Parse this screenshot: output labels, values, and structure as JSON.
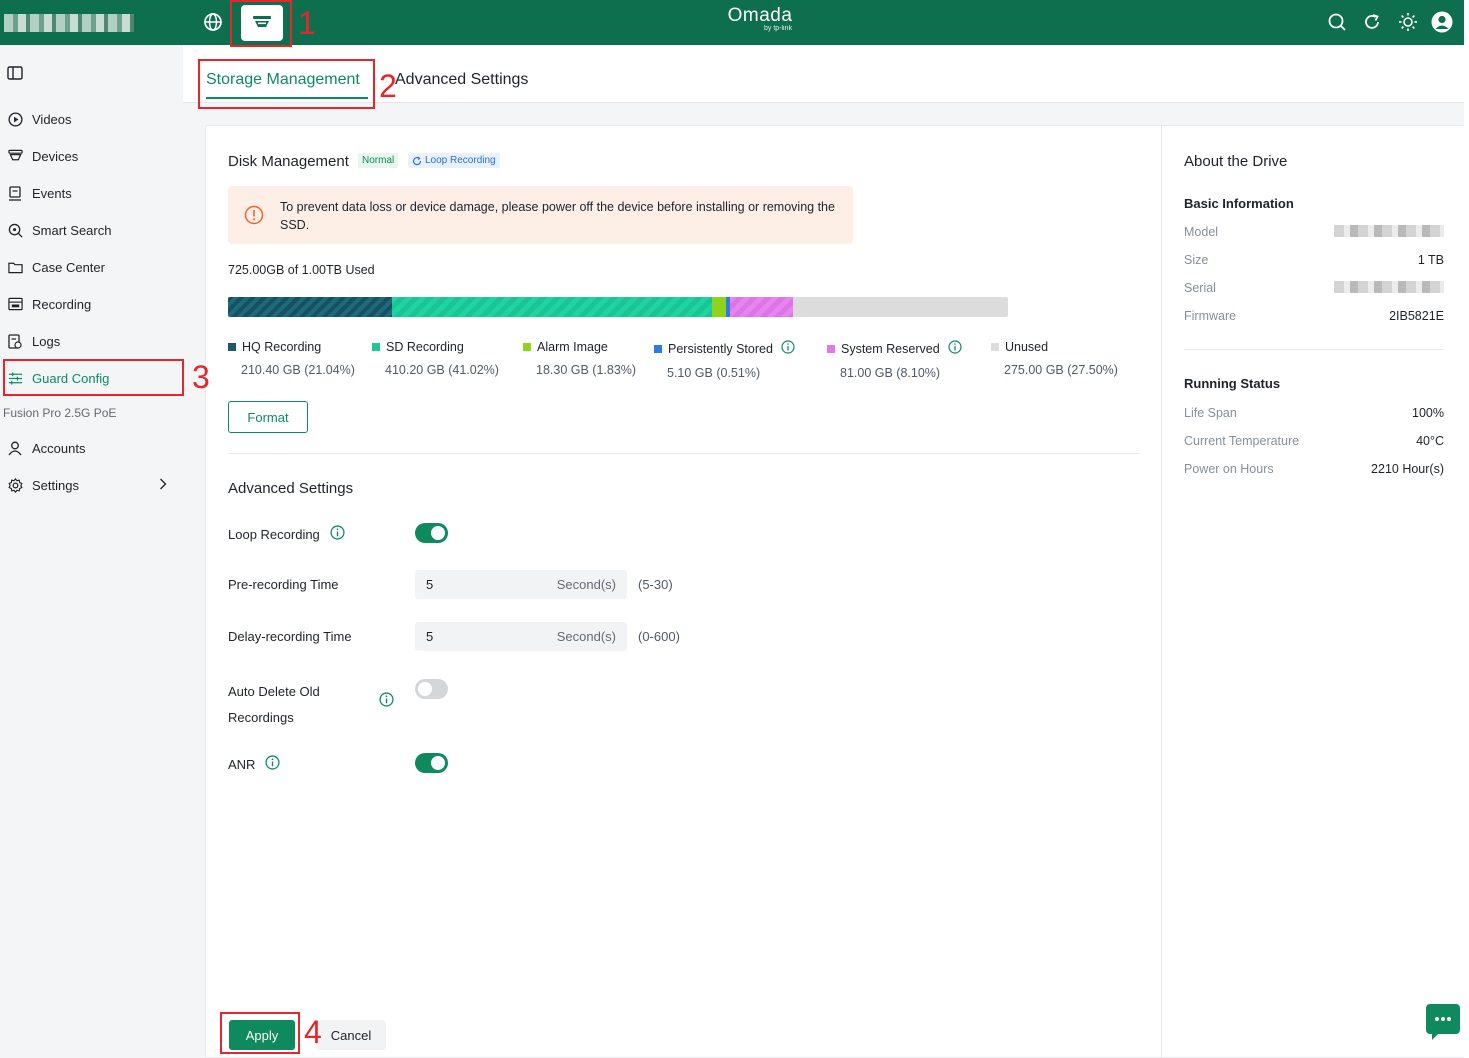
{
  "header": {
    "brand_name": "Omada",
    "brand_sub": "by tp-link"
  },
  "annotations": [
    "1",
    "2",
    "3",
    "4"
  ],
  "sidebar": {
    "items": [
      {
        "label": "Videos",
        "icon": "play-circle-icon"
      },
      {
        "label": "Devices",
        "icon": "camera-icon"
      },
      {
        "label": "Events",
        "icon": "events-icon"
      },
      {
        "label": "Smart Search",
        "icon": "smart-search-icon"
      },
      {
        "label": "Case Center",
        "icon": "folder-icon"
      },
      {
        "label": "Recording",
        "icon": "recording-icon"
      },
      {
        "label": "Logs",
        "icon": "logs-icon"
      },
      {
        "label": "Guard Config",
        "icon": "config-sliders-icon",
        "active": true
      }
    ],
    "section_label": "Fusion Pro 2.5G PoE",
    "bottom_items": [
      {
        "label": "Accounts",
        "icon": "user-icon"
      },
      {
        "label": "Settings",
        "icon": "gear-icon"
      }
    ]
  },
  "tabs": {
    "storage": "Storage Management",
    "advanced": "Advanced Settings"
  },
  "disk": {
    "title": "Disk Management",
    "badge_status": "Normal",
    "badge_loop": "Loop Recording",
    "warning": "To prevent data loss or device damage, please power off the device before installing or removing the SSD.",
    "usage": "725.00GB of 1.00TB Used",
    "segments_percent": {
      "hq": 21.04,
      "sd": 41.02,
      "alarm": 1.83,
      "persistent": 0.51,
      "system": 8.1,
      "unused": 27.5
    },
    "legend": [
      {
        "label": "HQ Recording",
        "value": "210.40 GB (21.04%)",
        "color": "#1c5a6b",
        "info": false
      },
      {
        "label": "SD Recording",
        "value": "410.20 GB (41.02%)",
        "color": "#1fc795",
        "info": false
      },
      {
        "label": "Alarm Image",
        "value": "18.30 GB (1.83%)",
        "color": "#8fd31d",
        "info": false
      },
      {
        "label": "Persistently Stored",
        "value": "5.10 GB (0.51%)",
        "color": "#2e7ae6",
        "info": true
      },
      {
        "label": "System Reserved",
        "value": "81.00 GB (8.10%)",
        "color": "#e07ae9",
        "info": true
      },
      {
        "label": "Unused",
        "value": "275.00 GB (27.50%)",
        "color": "#dcdcdc",
        "info": false
      }
    ],
    "format_label": "Format"
  },
  "advanced": {
    "title": "Advanced Settings",
    "loop_label": "Loop Recording",
    "loop_on": true,
    "pre_label": "Pre-recording Time",
    "pre_value": "5",
    "pre_unit": "Second(s)",
    "pre_range": "(5-30)",
    "delay_label": "Delay-recording Time",
    "delay_value": "5",
    "delay_unit": "Second(s)",
    "delay_range": "(0-600)",
    "auto_label_1": "Auto Delete Old",
    "auto_label_2": "Recordings",
    "auto_on": false,
    "anr_label": "ANR",
    "anr_on": true
  },
  "actions": {
    "apply": "Apply",
    "cancel": "Cancel"
  },
  "drive": {
    "title": "About the Drive",
    "basic_title": "Basic Information",
    "model_label": "Model",
    "size_label": "Size",
    "size_value": "1 TB",
    "serial_label": "Serial",
    "firmware_label": "Firmware",
    "firmware_value": "2IB5821E",
    "running_title": "Running Status",
    "life_label": "Life Span",
    "life_value": "100%",
    "temp_label": "Current Temperature",
    "temp_value": "40°C",
    "hours_label": "Power on Hours",
    "hours_value": "2210 Hour(s)"
  },
  "colors": {
    "accent": "#0f8a5f",
    "topbar": "#0e6f4f",
    "annotation": "#e6262a"
  }
}
